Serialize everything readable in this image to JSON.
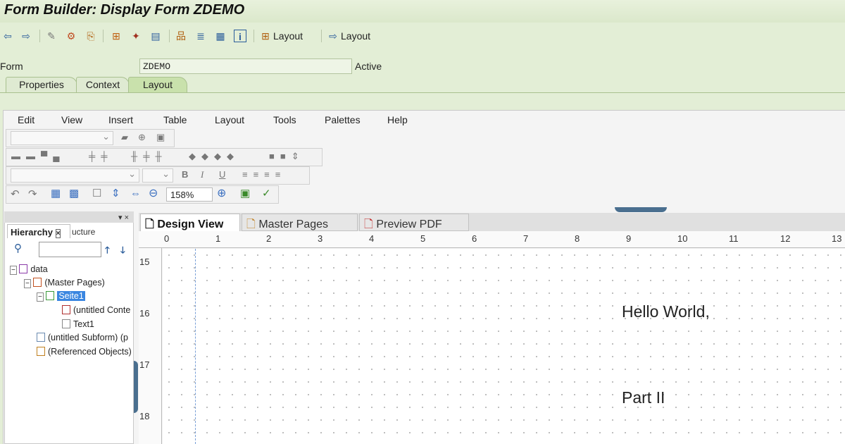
{
  "window": {
    "title": "Form Builder: Display Form ZDEMO"
  },
  "toolbar": {
    "layout_btn_1": "Layout",
    "layout_btn_2": "Layout"
  },
  "form": {
    "label": "Form",
    "value": "ZDEMO",
    "status": "Active"
  },
  "tabs": [
    {
      "label": "Properties"
    },
    {
      "label": "Context"
    },
    {
      "label": "Layout"
    }
  ],
  "menu": [
    "Edit",
    "View",
    "Insert",
    "Table",
    "Layout",
    "Tools",
    "Palettes",
    "Help"
  ],
  "zoom": {
    "value": "158%"
  },
  "hierarchy": {
    "tab_label": "Hierarchy",
    "struct_label": "ucture",
    "tree": [
      "data",
      "(Master Pages)",
      "Seite1",
      "(untitled Conte",
      "Text1",
      "(untitled Subform) (p",
      "(Referenced Objects)"
    ]
  },
  "doc_tabs": [
    {
      "label": "Design View"
    },
    {
      "label": "Master Pages"
    },
    {
      "label": "Preview PDF"
    }
  ],
  "ruler": {
    "h": [
      "0",
      "1",
      "2",
      "3",
      "4",
      "5",
      "6",
      "7",
      "8",
      "9",
      "10",
      "11",
      "12",
      "13"
    ],
    "v": [
      "15",
      "16",
      "17",
      "18"
    ]
  },
  "canvas": {
    "text1": "Hello World,",
    "text2": "Part II"
  },
  "colors": {
    "accent_green": "#c9e1ac",
    "selection_blue": "#3a86e0"
  }
}
